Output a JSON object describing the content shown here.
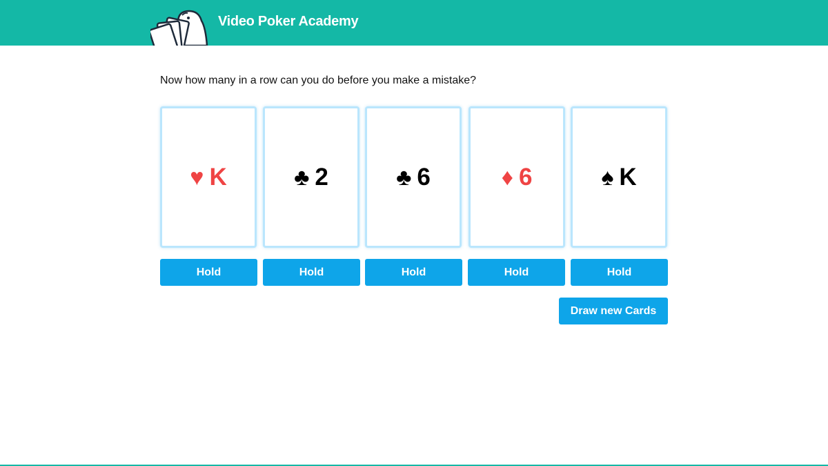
{
  "header": {
    "title": "Video Poker Academy",
    "logo_icon": "playing-cards-mascot-icon",
    "background_color": "#14b8a6"
  },
  "game": {
    "prompt": "Now how many in a row can you do before you make a mistake?",
    "cards": [
      {
        "suit": "hearts",
        "suit_symbol": "♥",
        "rank": "K",
        "color": "#ef4444"
      },
      {
        "suit": "clubs",
        "suit_symbol": "♣",
        "rank": "2",
        "color": "#000000"
      },
      {
        "suit": "clubs",
        "suit_symbol": "♣",
        "rank": "6",
        "color": "#000000"
      },
      {
        "suit": "diamonds",
        "suit_symbol": "♦",
        "rank": "6",
        "color": "#ef4444"
      },
      {
        "suit": "spades",
        "suit_symbol": "♠",
        "rank": "K",
        "color": "#000000"
      }
    ],
    "hold_label": "Hold",
    "draw_label": "Draw new Cards",
    "button_color": "#0ea5e9",
    "card_border_color": "#bae6fd"
  }
}
